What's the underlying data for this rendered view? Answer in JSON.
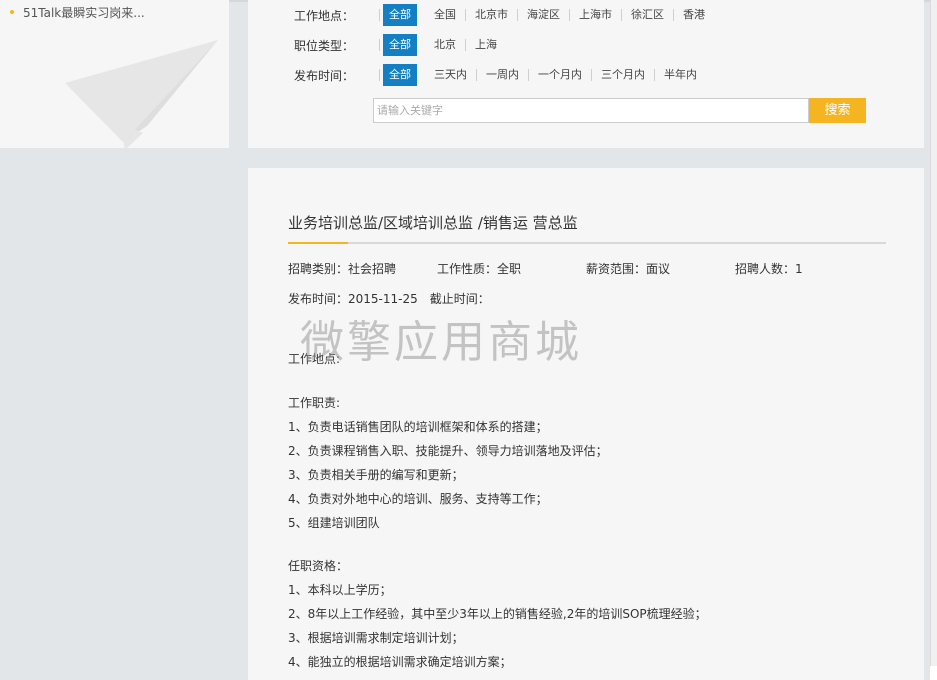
{
  "left_panel": {
    "recent_item": "51Talk最瞬实习岗来..."
  },
  "filters": {
    "location": {
      "label": "工作地点：",
      "options": [
        "全部",
        "全国",
        "北京市",
        "海淀区",
        "上海市",
        "徐汇区",
        "香港"
      ],
      "selected": "全部"
    },
    "position_type": {
      "label": "职位类型：",
      "options": [
        "全部",
        "北京",
        "上海"
      ],
      "selected": "全部"
    },
    "publish_time": {
      "label": "发布时间：",
      "options": [
        "全部",
        "三天内",
        "一周内",
        "一个月内",
        "三个月内",
        "半年内"
      ],
      "selected": "全部"
    },
    "search": {
      "placeholder": "请输入关键字",
      "button_label": "搜索"
    }
  },
  "job": {
    "title": "业务培训总监/区域培训总监 /销售运 营总监",
    "category": "招聘类别：社会招聘",
    "nature": "工作性质：全职",
    "salary": "薪资范围：面议",
    "headcount": "招聘人数：1",
    "publish_date": "发布时间：2015-11-25",
    "deadline": "截止时间：",
    "location_label": "工作地点:",
    "duties_label": "工作职责:",
    "duties": [
      "1、负责电话销售团队的培训框架和体系的搭建；",
      "2、负责课程销售入职、技能提升、领导力培训落地及评估；",
      "3、负责相关手册的编写和更新；",
      "4、负责对外地中心的培训、服务、支持等工作；",
      "5、组建培训团队"
    ],
    "qualifications_label": "任职资格：",
    "qualifications": [
      "1、本科以上学历；",
      "2、8年以上工作经验，其中至少3年以上的销售经验,2年的培训SOP梳理经验；",
      "3、根据培训需求制定培训计划；",
      "4、能独立的根据培训需求确定培训方案；"
    ]
  },
  "watermark": "微擎应用商城",
  "colors": {
    "accent_blue": "#1480c3",
    "accent_yellow": "#f5b521",
    "card_bg": "#f6f6f6",
    "page_bg": "#e2e6e9"
  }
}
